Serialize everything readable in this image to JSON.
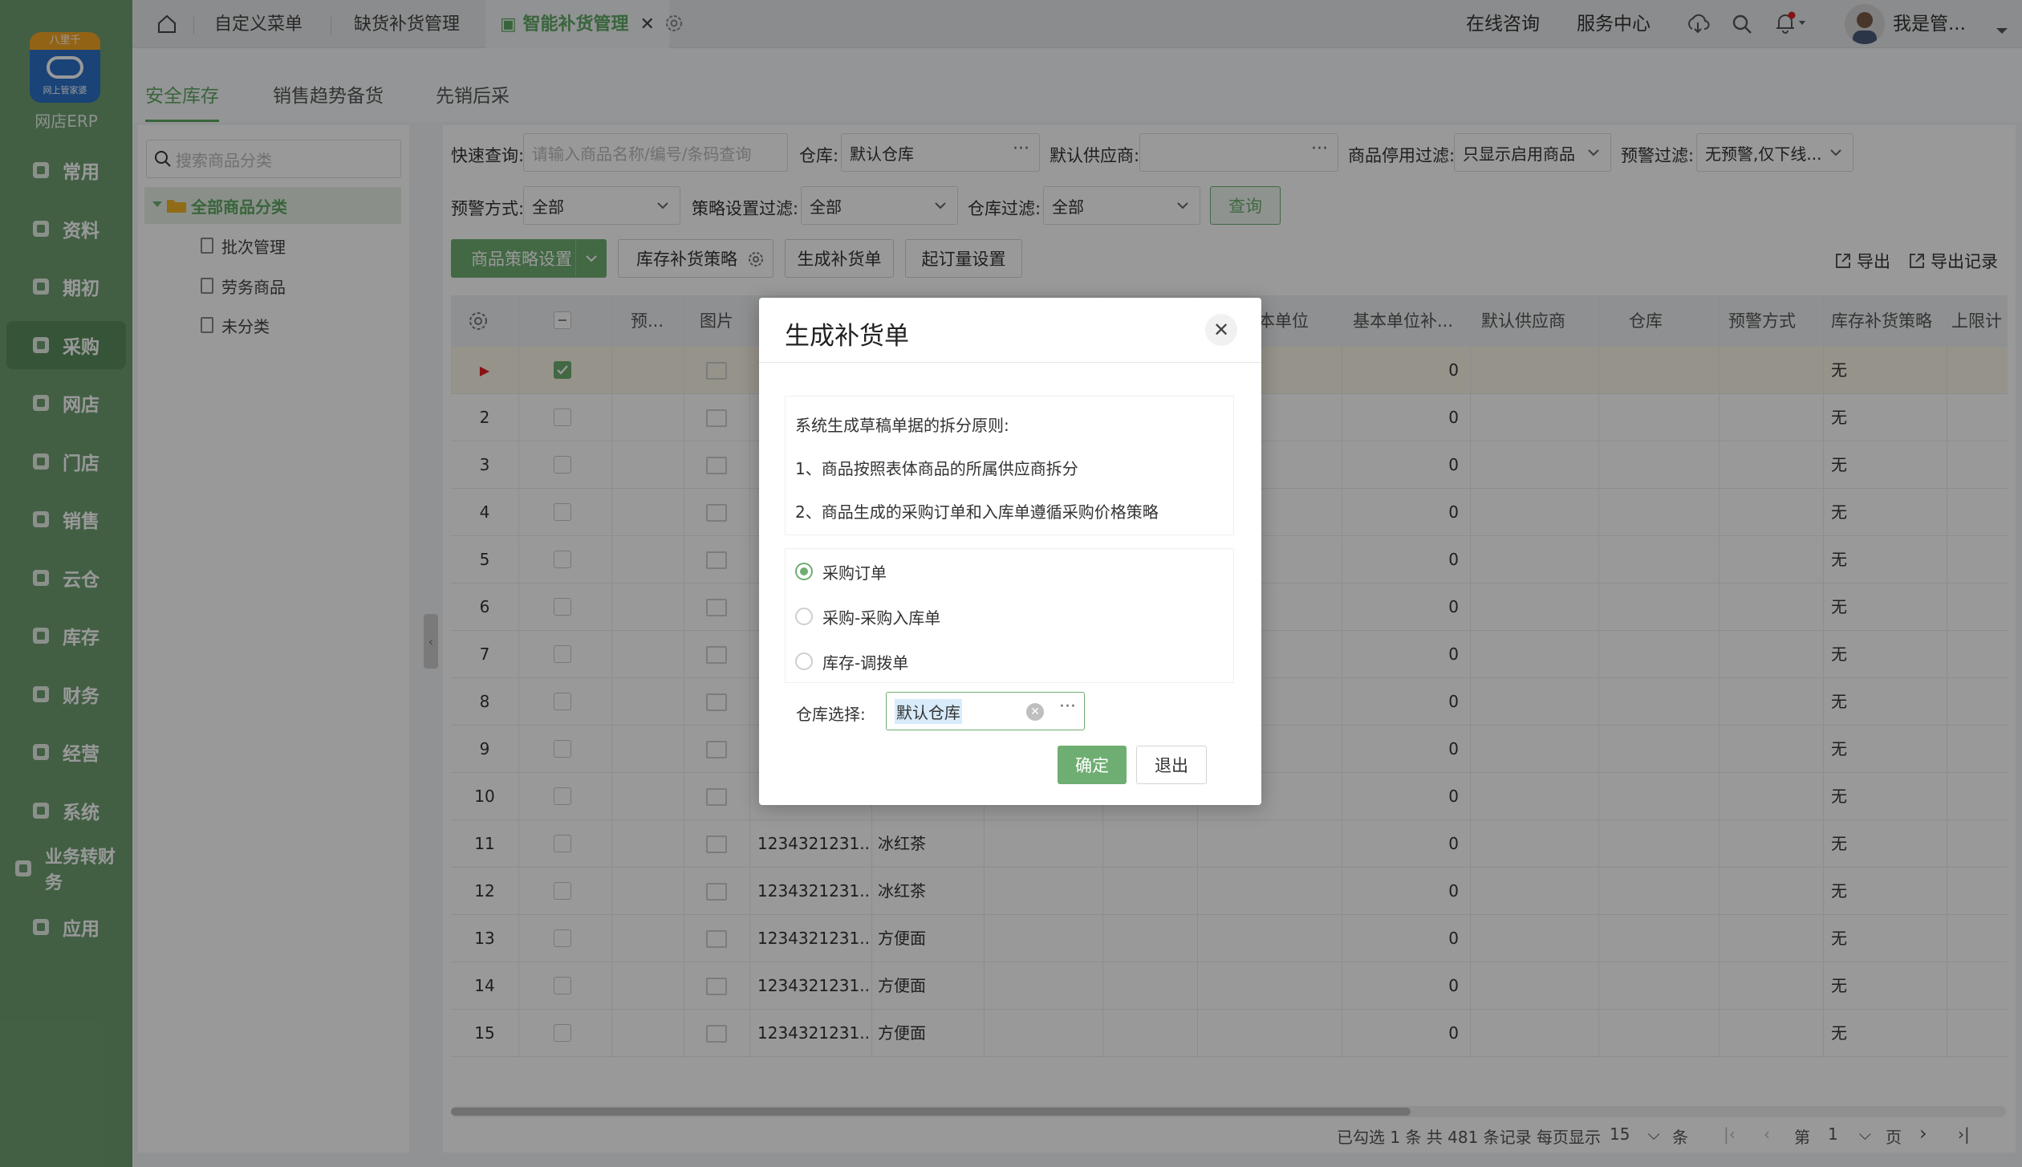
{
  "app": {
    "logo_ribbon": "八里千",
    "logo_sub": "网上管家婆",
    "logo_text": "网店ERP"
  },
  "nav": [
    {
      "label": "常用",
      "icon": "star-icon"
    },
    {
      "label": "资料",
      "icon": "profile-icon"
    },
    {
      "label": "期初",
      "icon": "target-icon"
    },
    {
      "label": "采购",
      "icon": "purchase-icon",
      "active": true
    },
    {
      "label": "网店",
      "icon": "shop-icon"
    },
    {
      "label": "门店",
      "icon": "pie-icon"
    },
    {
      "label": "销售",
      "icon": "bar-chart-icon"
    },
    {
      "label": "云仓",
      "icon": "warehouse-icon"
    },
    {
      "label": "库存",
      "icon": "home-icon"
    },
    {
      "label": "财务",
      "icon": "finance-icon"
    },
    {
      "label": "经营",
      "icon": "trend-icon"
    },
    {
      "label": "系统",
      "icon": "gear-icon"
    },
    {
      "label": "业务转财务",
      "icon": "transfer-icon"
    },
    {
      "label": "应用",
      "icon": "plus-icon"
    }
  ],
  "topbar": {
    "tabs": [
      "自定义菜单",
      "缺货补货管理",
      "智能补货管理"
    ],
    "online": "在线咨询",
    "service": "服务中心",
    "user": "我是管..."
  },
  "subtabs": [
    "安全库存",
    "销售趋势备货",
    "先销后采"
  ],
  "tree": {
    "search_placeholder": "搜索商品分类",
    "root": "全部商品分类",
    "children": [
      "批次管理",
      "劳务商品",
      "未分类"
    ]
  },
  "filters": {
    "quick_label": "快速查询:",
    "quick_placeholder": "请输入商品名称/编号/条码查询",
    "warehouse_label": "仓库:",
    "warehouse_value": "默认仓库",
    "supplier_label": "默认供应商:",
    "supplier_value": "",
    "disable_label": "商品停用过滤:",
    "disable_value": "只显示启用商品",
    "warn_filter_label": "预警过滤:",
    "warn_filter_value": "无预警,仅下线...",
    "warn_mode_label": "预警方式:",
    "warn_mode_value": "全部",
    "policy_label": "策略设置过滤:",
    "policy_value": "全部",
    "wh_filter_label": "仓库过滤:",
    "wh_filter_value": "全部",
    "query_btn": "查询"
  },
  "toolbar": {
    "strategy": "商品策略设置",
    "replenish_policy": "库存补货策略",
    "gen": "生成补货单",
    "moq": "起订量设置",
    "export": "导出",
    "export_log": "导出记录"
  },
  "table": {
    "headers": [
      "预...",
      "图片",
      "本单位",
      "基本单位补...",
      "默认供应商",
      "仓库",
      "预警方式",
      "库存补货策略",
      "上限计"
    ],
    "rows": [
      {
        "no": "▶",
        "code": "",
        "name": "",
        "qty": "0",
        "policy": "无"
      },
      {
        "no": "2",
        "code": "",
        "name": "",
        "qty": "0",
        "policy": "无"
      },
      {
        "no": "3",
        "code": "",
        "name": "",
        "qty": "0",
        "policy": "无"
      },
      {
        "no": "4",
        "code": "",
        "name": "",
        "qty": "0",
        "policy": "无"
      },
      {
        "no": "5",
        "code": "",
        "name": "",
        "qty": "0",
        "policy": "无"
      },
      {
        "no": "6",
        "code": "",
        "name": "",
        "qty": "0",
        "policy": "无"
      },
      {
        "no": "7",
        "code": "",
        "name": "",
        "qty": "0",
        "policy": "无"
      },
      {
        "no": "8",
        "code": "",
        "name": "",
        "qty": "0",
        "policy": "无"
      },
      {
        "no": "9",
        "code": "",
        "name": "",
        "qty": "0",
        "policy": "无"
      },
      {
        "no": "10",
        "code": "",
        "name": "",
        "qty": "0",
        "policy": "无"
      },
      {
        "no": "11",
        "code": "1234321231...",
        "name": "冰红茶",
        "qty": "0",
        "policy": "无"
      },
      {
        "no": "12",
        "code": "1234321231...",
        "name": "冰红茶",
        "qty": "0",
        "policy": "无"
      },
      {
        "no": "13",
        "code": "1234321231...",
        "name": "方便面",
        "qty": "0",
        "policy": "无"
      },
      {
        "no": "14",
        "code": "1234321231...",
        "name": "方便面",
        "qty": "0",
        "policy": "无"
      },
      {
        "no": "15",
        "code": "1234321231...",
        "name": "方便面",
        "qty": "0",
        "policy": "无"
      }
    ]
  },
  "pager": {
    "summary": "已勾选 1 条 共 481 条记录 每页显示",
    "per_page": "15",
    "unit": "条",
    "page_prefix": "第",
    "page": "1",
    "page_suffix": "页"
  },
  "dialog": {
    "title": "生成补货单",
    "rule_title": "系统生成草稿单据的拆分原则:",
    "rule1": "1、商品按照表体商品的所属供应商拆分",
    "rule2": "2、商品生成的采购订单和入库单遵循采购价格策略",
    "options": [
      "采购订单",
      "采购-采购入库单",
      "库存-调拨单"
    ],
    "selected": 0,
    "wh_label": "仓库选择:",
    "wh_value": "默认仓库",
    "ok": "确定",
    "cancel": "退出"
  },
  "colors": {
    "accent": "#6fae72",
    "sidebar": "#6f9f72",
    "selected_row": "#fbf5e6",
    "marker": "#e02020"
  }
}
